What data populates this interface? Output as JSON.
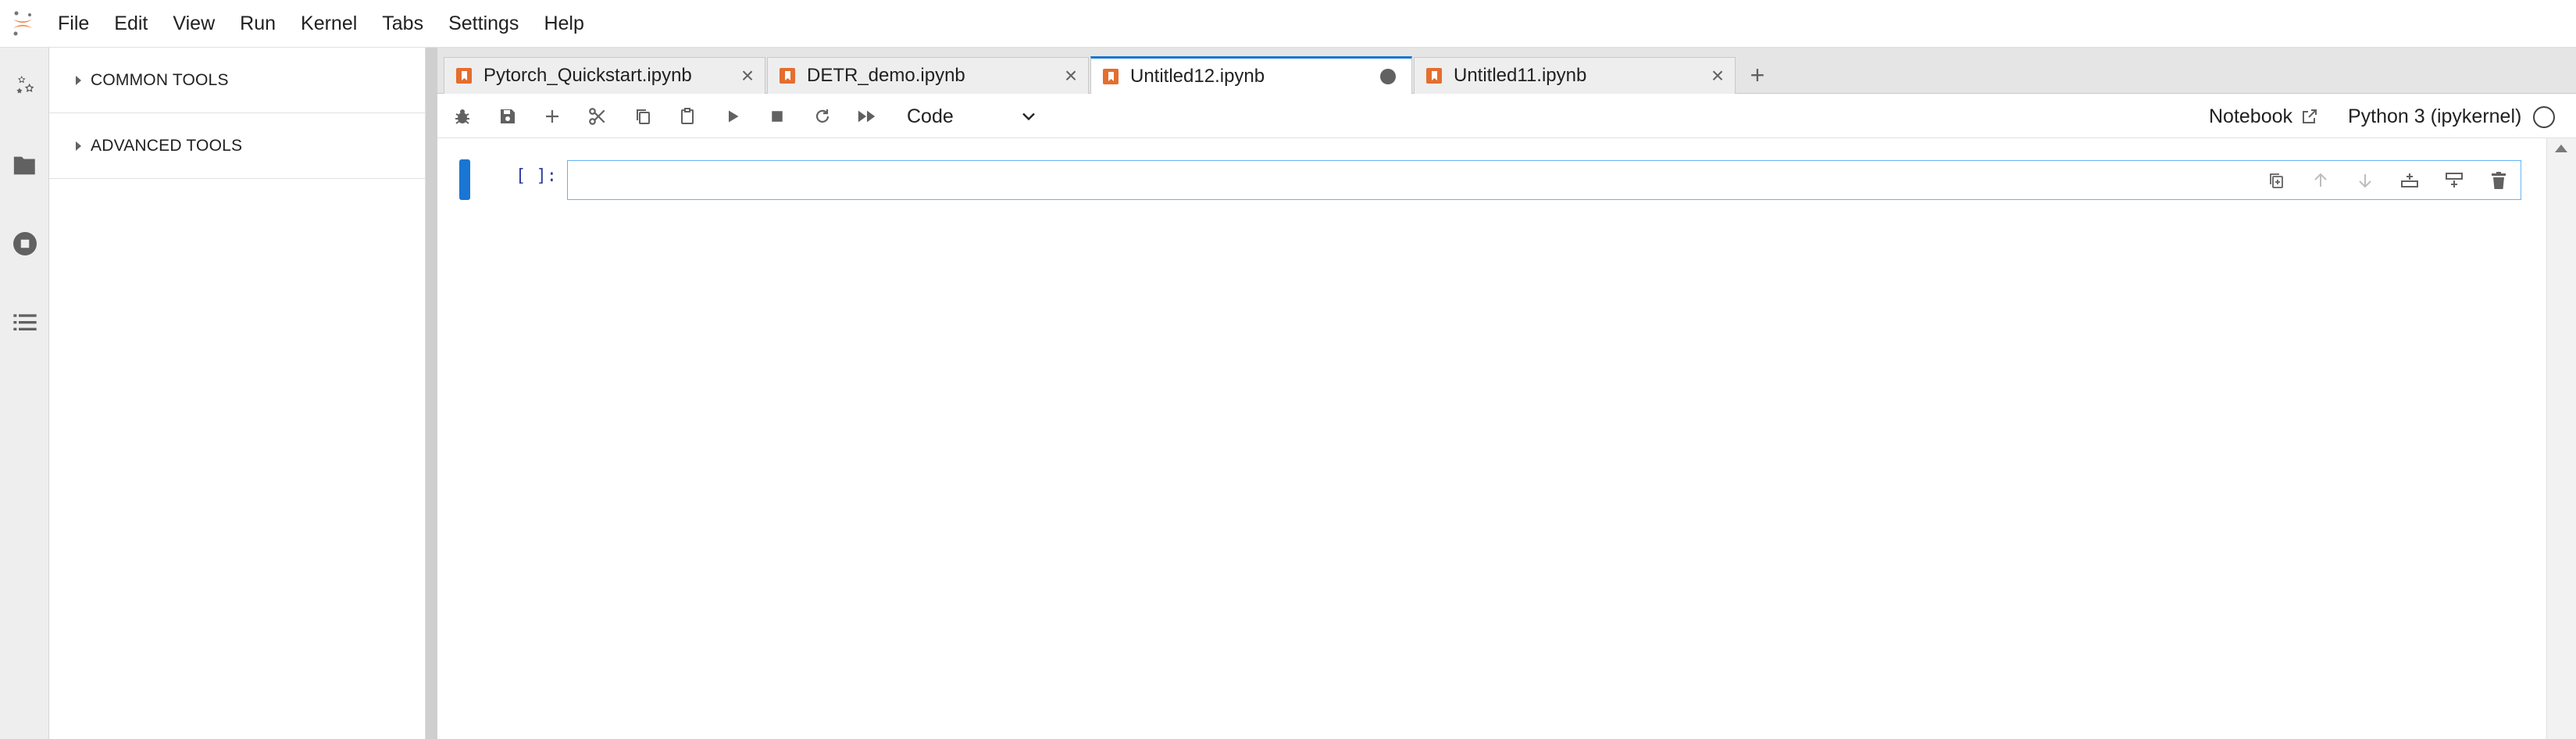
{
  "menubar": {
    "items": [
      "File",
      "Edit",
      "View",
      "Run",
      "Kernel",
      "Tabs",
      "Settings",
      "Help"
    ]
  },
  "activity_bar": {
    "icons": [
      "property-inspector-icon",
      "folder-icon",
      "running-kernels-icon",
      "table-of-contents-icon"
    ]
  },
  "sidebar": {
    "sections": [
      "COMMON TOOLS",
      "ADVANCED TOOLS"
    ]
  },
  "tabs": [
    {
      "label": "Pytorch_Quickstart.ipynb",
      "active": false,
      "dirty": false
    },
    {
      "label": "DETR_demo.ipynb",
      "active": false,
      "dirty": false
    },
    {
      "label": "Untitled12.ipynb",
      "active": true,
      "dirty": true
    },
    {
      "label": "Untitled11.ipynb",
      "active": false,
      "dirty": false
    }
  ],
  "toolbar": {
    "cell_type": "Code",
    "notebook_label": "Notebook",
    "kernel_label": "Python 3 (ipykernel)"
  },
  "cell": {
    "prompt": "[ ]:",
    "content": ""
  },
  "colors": {
    "accent": "#1976d2",
    "notebook_icon": "#e46e2e",
    "logo": "#f37726"
  }
}
